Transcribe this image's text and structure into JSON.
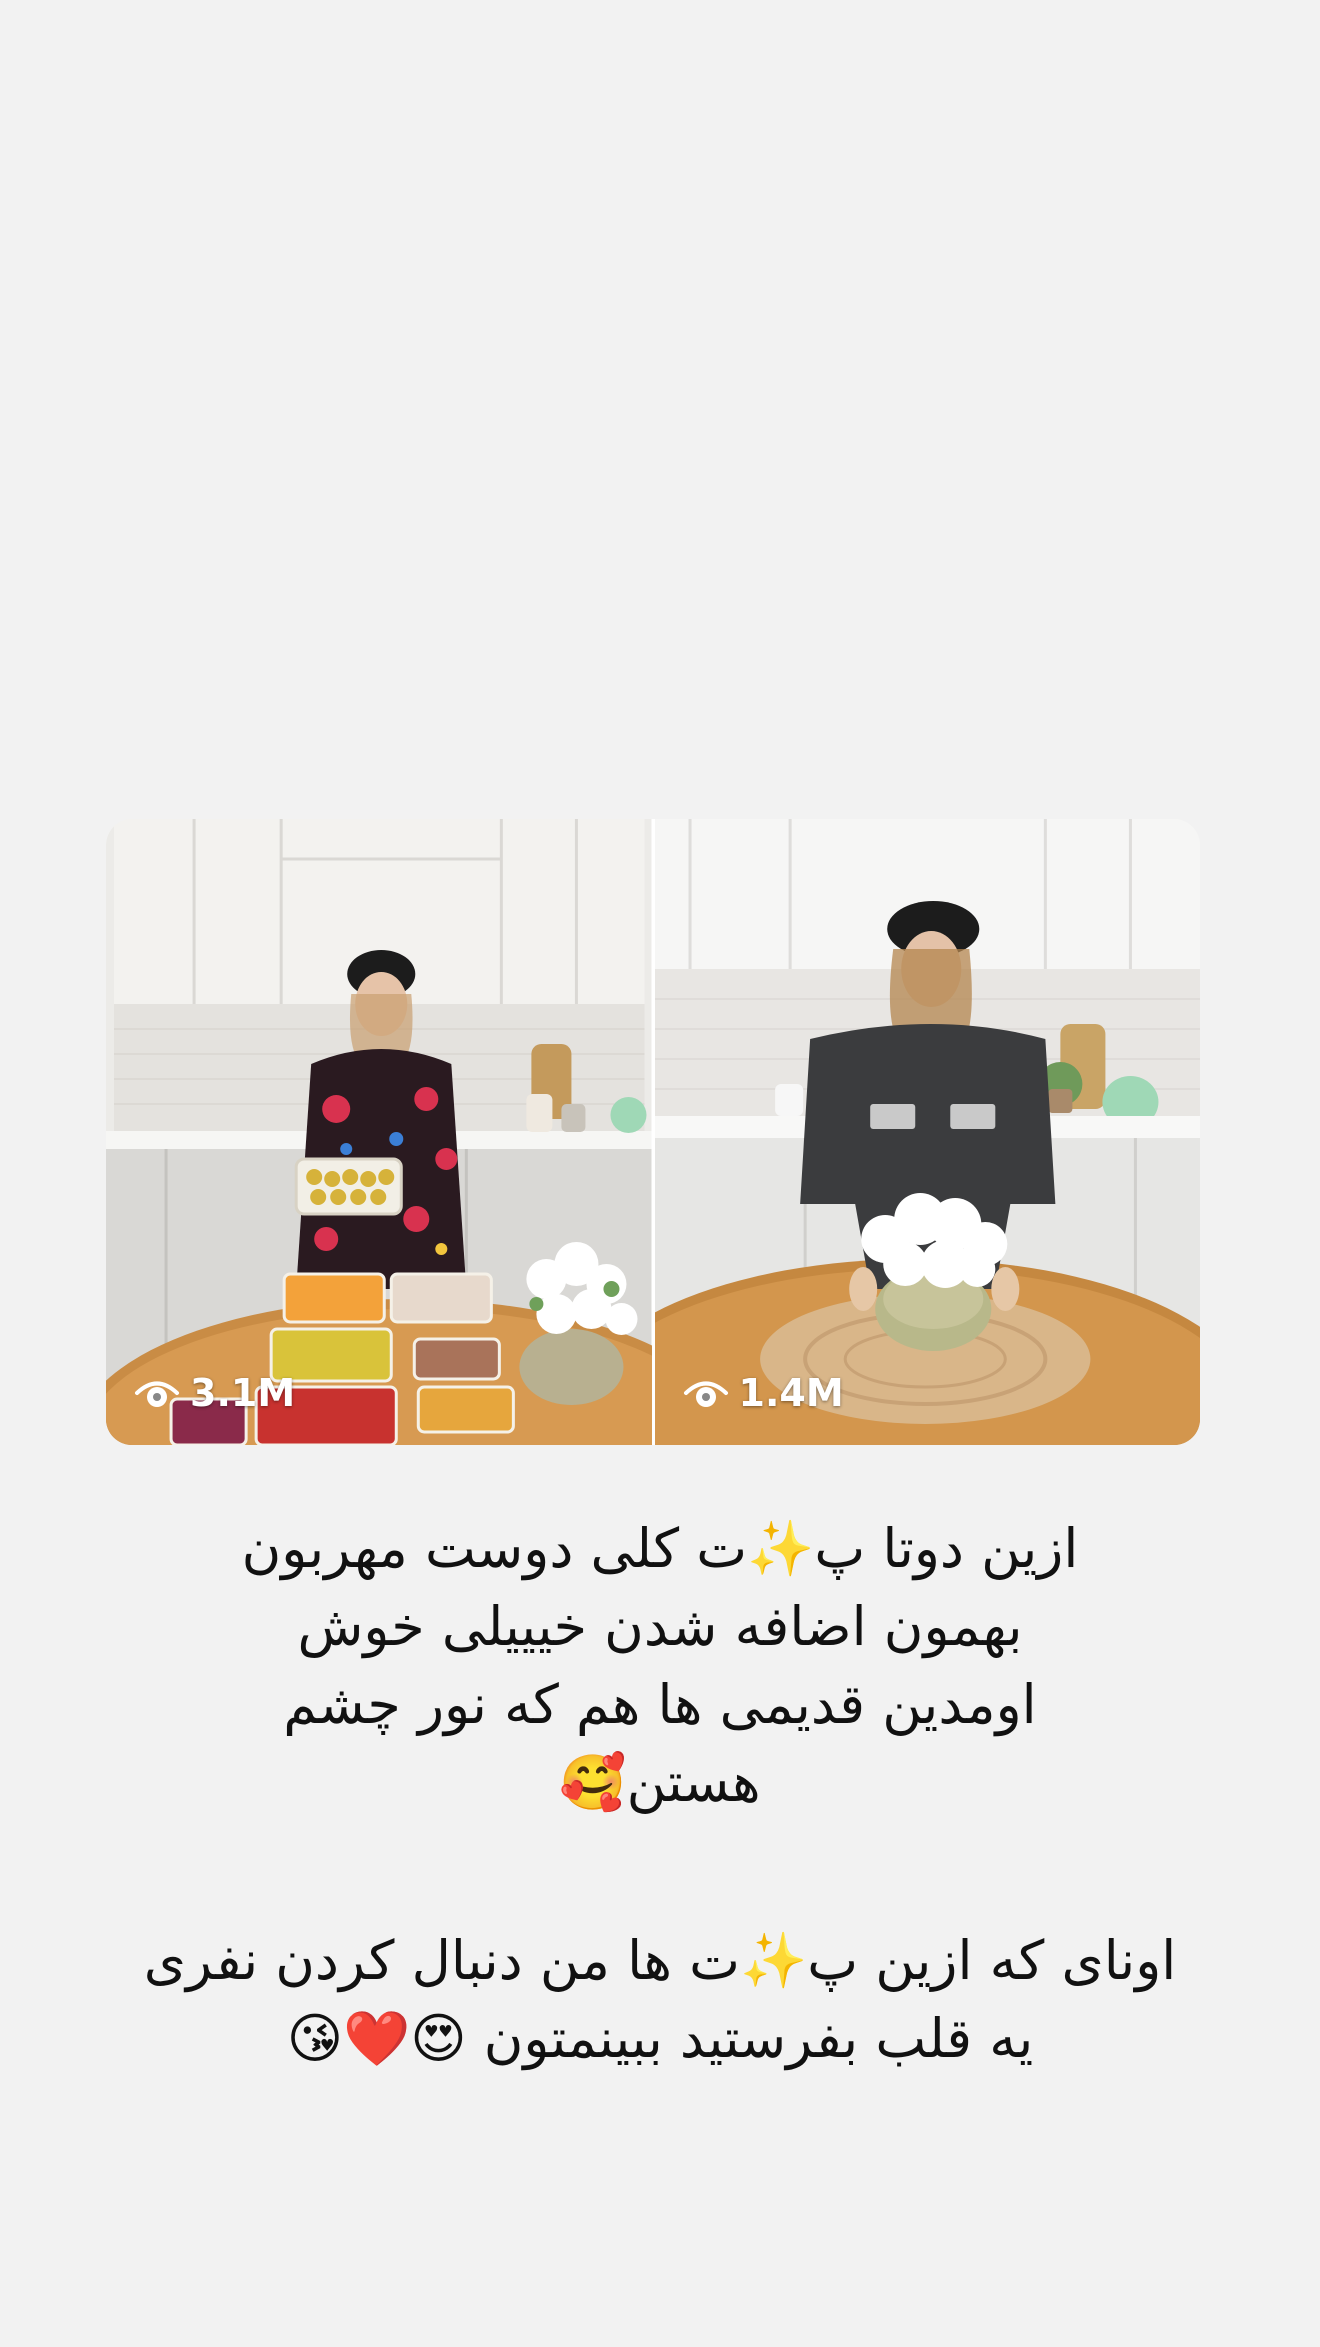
{
  "videos": [
    {
      "views": "3.1M",
      "icon": "eye-icon",
      "scene": "woman in black cap and floral dress holding a container of food over a round wooden table with prepared food boxes in a white kitchen"
    },
    {
      "views": "1.4M",
      "icon": "eye-icon",
      "scene": "woman in black cap and dark denim shirt placing a vase of white flowers on a round wooden table in a white kitchen"
    }
  ],
  "caption": {
    "paragraph1": [
      "ازین دوتا پ✨ت کلی دوست مهربون",
      "بهمون اضافه شدن خیییلی خوش",
      "اومدین قدیمی ها هم که نور چشم",
      "هستن🥰"
    ],
    "paragraph2": [
      "اونای که ازین پ✨ت ها من دنبال کردن نفری",
      "یه قلب بفرستید ببینمتون 😍❤️😘"
    ]
  },
  "colors": {
    "background": "#f2f2f2",
    "text": "#111111",
    "overlay_text": "#ffffff"
  }
}
